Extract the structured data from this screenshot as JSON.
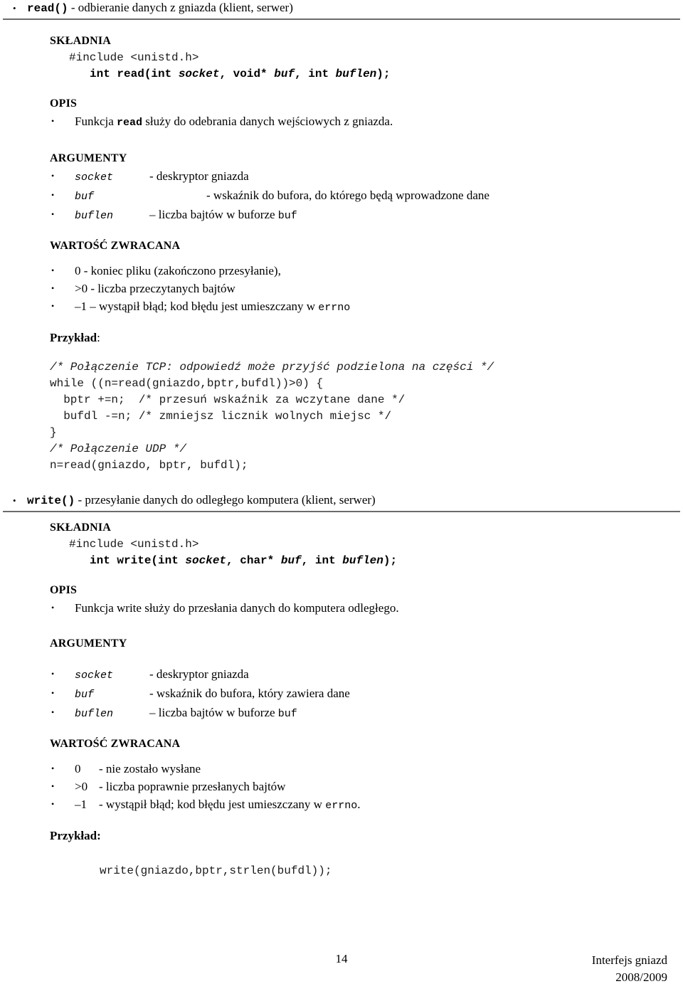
{
  "document": {
    "language": "pl",
    "footer": {
      "page_number": "14",
      "course_line1": "Interfejs gniazd",
      "course_line2": "2008/2009"
    }
  },
  "sections": [
    {
      "id": "read",
      "heading_fn": "read()",
      "heading_rest": " - odbieranie danych z gniazda (klient, serwer)",
      "skladnia_label": "SKŁADNIA",
      "include_line": "#include <unistd.h>",
      "signature": {
        "prefix": "int read(int ",
        "p1": "socket",
        "mid1": ", void* ",
        "p2": "buf",
        "mid2": ", int ",
        "p3": "buflen",
        "suffix": ");"
      },
      "opis_label": "OPIS",
      "opis_items": [
        {
          "pre": "Funkcja ",
          "code": "read",
          "post": " służy do odebrania danych wejściowych z gniazda."
        }
      ],
      "argumenty_label": "ARGUMENTY",
      "arguments": [
        {
          "term": "socket",
          "desc": "- deskryptor gniazda",
          "desc_suffix": "",
          "desc_code": ""
        },
        {
          "term": "buf",
          "desc": "- wskaźnik do bufora, do którego będą wprowadzone dane",
          "desc_suffix": "",
          "desc_code": ""
        },
        {
          "term": "buflen",
          "desc": "– liczba bajtów w buforze ",
          "desc_code": "buf",
          "desc_suffix": ""
        }
      ],
      "arg_buf_offset": true,
      "wartosc_label": "WARTOŚĆ ZWRACANA",
      "returns": [
        {
          "key": "0",
          "desc": "- koniec pliku (zakończono przesyłanie),",
          "code": "",
          "tail": ""
        },
        {
          "key": ">0",
          "desc": "- liczba przeczytanych bajtów",
          "code": "",
          "tail": ""
        },
        {
          "key": "–1",
          "desc": "– wystąpił błąd; kod błędu jest umieszczany w ",
          "code": "errno",
          "tail": ""
        }
      ],
      "returns_key_width": false,
      "przyklad_label": "Przykład",
      "przyklad_colon": ":",
      "przyklad_bold_colon": false,
      "code_lines": [
        {
          "text": "/* Połączenie TCP: odpowiedź może przyjść podzielona na części */",
          "style": "italic"
        },
        {
          "text": "while ((n=read(gniazdo,bptr,bufdl))>0) {",
          "style": "plain"
        },
        {
          "text": "  bptr +=n;  /* przesuń wskaźnik za wczytane dane */",
          "style": "mixed-comment"
        },
        {
          "text": "  bufdl -=n; /* zmniejsz licznik wolnych miejsc */",
          "style": "mixed-comment"
        },
        {
          "text": "}",
          "style": "plain"
        },
        {
          "text": "",
          "style": "plain"
        },
        {
          "text": "/* Połączenie UDP */",
          "style": "italic"
        },
        {
          "text": "n=read(gniazdo, bptr, bufdl);",
          "style": "plain"
        }
      ]
    },
    {
      "id": "write",
      "heading_fn": "write()",
      "heading_rest": " - przesyłanie danych do odległego komputera (klient, serwer)",
      "skladnia_label": "SKŁADNIA",
      "include_line": "#include <unistd.h>",
      "signature": {
        "prefix": "int write(int ",
        "p1": "socket",
        "mid1": ", char* ",
        "p2": "buf",
        "mid2": ", int ",
        "p3": "buflen",
        "suffix": ");"
      },
      "opis_label": "OPIS",
      "opis_items": [
        {
          "pre": "Funkcja write służy do przesłania danych do komputera odległego.",
          "code": "",
          "post": ""
        }
      ],
      "argumenty_label": "ARGUMENTY",
      "arguments": [
        {
          "term": "socket",
          "desc": "- deskryptor gniazda",
          "desc_code": "",
          "desc_suffix": ""
        },
        {
          "term": "buf",
          "desc": "- wskaźnik do bufora, który zawiera dane",
          "desc_code": "",
          "desc_suffix": ""
        },
        {
          "term": "buflen",
          "desc": "– liczba bajtów w buforze ",
          "desc_code": "buf",
          "desc_suffix": ""
        }
      ],
      "wartosc_label": "WARTOŚĆ ZWRACANA",
      "returns": [
        {
          "key": "0",
          "desc": "- nie zostało wysłane",
          "code": "",
          "tail": ""
        },
        {
          "key": ">0",
          "desc": "- liczba poprawnie przesłanych bajtów",
          "code": "",
          "tail": ""
        },
        {
          "key": "–1",
          "desc": "- wystąpił błąd; kod błędu jest umieszczany w ",
          "code": "errno",
          "tail": "."
        }
      ],
      "przyklad_label": "Przykład",
      "przyklad_colon": ":",
      "przyklad_bold_colon": true,
      "code_lines": [
        {
          "text": "write(gniazdo,bptr,strlen(bufdl));",
          "style": "plain-indented"
        }
      ]
    }
  ],
  "icons": {
    "bullet": "•"
  }
}
